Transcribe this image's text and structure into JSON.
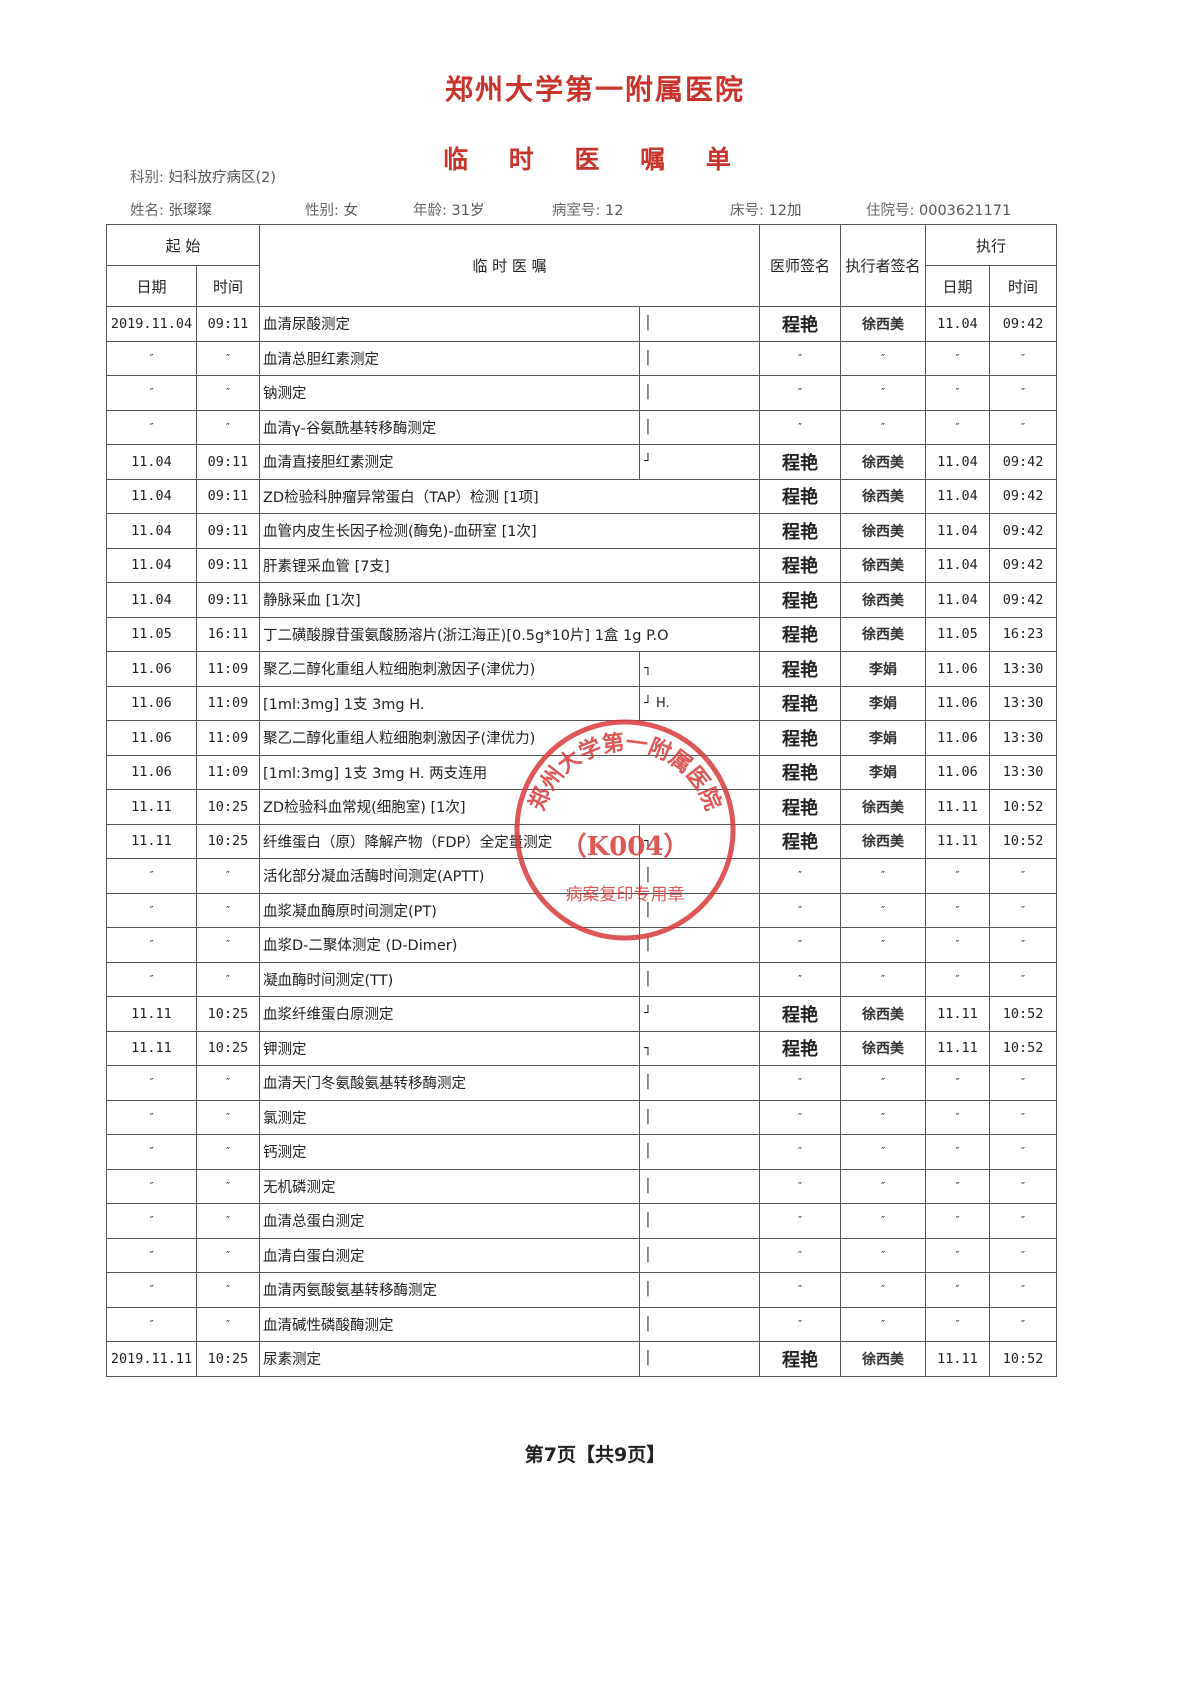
{
  "hospital_name": "郑州大学第一附属医院",
  "doc_title": "临 时 医 嘱 单",
  "patient": {
    "dept_label": "科别:",
    "dept": "妇科放疗病区(2)",
    "name_label": "姓名:",
    "name": "张璨璨",
    "sex_label": "性别:",
    "sex": "女",
    "age_label": "年龄:",
    "age": "31岁",
    "room_label": "病室号:",
    "room": "12",
    "bed_label": "床号:",
    "bed": "12加",
    "admission_label": "住院号:",
    "admission": "0003621171"
  },
  "table": {
    "start_header": "起   始",
    "date_header": "日期",
    "time_header": "时间",
    "order_header": "临 时 医 嘱",
    "doctor_header": "医师签名",
    "executor_header": "执行者签名",
    "exec_header": "执行",
    "exec_date_header": "日期",
    "exec_time_header": "时间",
    "rows": [
      {
        "date": "2019.11.04",
        "time": "09:11",
        "order": "血清尿酸测定",
        "mark": "│",
        "doctor": "程艳",
        "executor": "徐西美",
        "exec_date": "11.04",
        "exec_time": "09:42"
      },
      {
        "date": "″",
        "time": "″",
        "order": "血清总胆红素测定",
        "mark": "│",
        "doctor": "″",
        "executor": "″",
        "exec_date": "″",
        "exec_time": "″"
      },
      {
        "date": "″",
        "time": "″",
        "order": "钠测定",
        "mark": "│",
        "doctor": "″",
        "executor": "″",
        "exec_date": "″",
        "exec_time": "″"
      },
      {
        "date": "″",
        "time": "″",
        "order": "血清γ-谷氨酰基转移酶测定",
        "mark": "│",
        "doctor": "″",
        "executor": "″",
        "exec_date": "″",
        "exec_time": "″"
      },
      {
        "date": "11.04",
        "time": "09:11",
        "order": "血清直接胆红素测定",
        "mark": "┘",
        "doctor": "程艳",
        "executor": "徐西美",
        "exec_date": "11.04",
        "exec_time": "09:42"
      },
      {
        "date": "11.04",
        "time": "09:11",
        "order": "ZD检验科肿瘤异常蛋白（TAP）检测 [1项]",
        "mark": "",
        "doctor": "程艳",
        "executor": "徐西美",
        "exec_date": "11.04",
        "exec_time": "09:42"
      },
      {
        "date": "11.04",
        "time": "09:11",
        "order": "血管内皮生长因子检测(酶免)-血研室 [1次]",
        "mark": "",
        "doctor": "程艳",
        "executor": "徐西美",
        "exec_date": "11.04",
        "exec_time": "09:42"
      },
      {
        "date": "11.04",
        "time": "09:11",
        "order": "肝素锂采血管 [7支]",
        "mark": "",
        "doctor": "程艳",
        "executor": "徐西美",
        "exec_date": "11.04",
        "exec_time": "09:42"
      },
      {
        "date": "11.04",
        "time": "09:11",
        "order": "静脉采血 [1次]",
        "mark": "",
        "doctor": "程艳",
        "executor": "徐西美",
        "exec_date": "11.04",
        "exec_time": "09:42"
      },
      {
        "date": "11.05",
        "time": "16:11",
        "order": "丁二磺酸腺苷蛋氨酸肠溶片(浙江海正)[0.5g*10片] 1盒 1g P.O",
        "mark": "",
        "doctor": "程艳",
        "executor": "徐西美",
        "exec_date": "11.05",
        "exec_time": "16:23"
      },
      {
        "date": "11.06",
        "time": "11:09",
        "order": "聚乙二醇化重组人粒细胞刺激因子(津优力)",
        "mark": "┐",
        "doctor": "程艳",
        "executor": "李娟",
        "exec_date": "11.06",
        "exec_time": "13:30"
      },
      {
        "date": "11.06",
        "time": "11:09",
        "order": "[1ml:3mg] 1支 3mg H.",
        "mark": "┘ H.",
        "doctor": "程艳",
        "executor": "李娟",
        "exec_date": "11.06",
        "exec_time": "13:30"
      },
      {
        "date": "11.06",
        "time": "11:09",
        "order": "聚乙二醇化重组人粒细胞刺激因子(津优力)",
        "mark": "",
        "doctor": "程艳",
        "executor": "李娟",
        "exec_date": "11.06",
        "exec_time": "13:30"
      },
      {
        "date": "11.06",
        "time": "11:09",
        "order": "[1ml:3mg] 1支 3mg H. 两支连用",
        "mark": "",
        "doctor": "程艳",
        "executor": "李娟",
        "exec_date": "11.06",
        "exec_time": "13:30"
      },
      {
        "date": "11.11",
        "time": "10:25",
        "order": "ZD检验科血常规(细胞室) [1次]",
        "mark": "",
        "doctor": "程艳",
        "executor": "徐西美",
        "exec_date": "11.11",
        "exec_time": "10:52"
      },
      {
        "date": "11.11",
        "time": "10:25",
        "order": "纤维蛋白（原）降解产物（FDP）全定量测定",
        "mark": "┐",
        "doctor": "程艳",
        "executor": "徐西美",
        "exec_date": "11.11",
        "exec_time": "10:52"
      },
      {
        "date": "″",
        "time": "″",
        "order": "活化部分凝血活酶时间测定(APTT)",
        "mark": "│",
        "doctor": "″",
        "executor": "″",
        "exec_date": "″",
        "exec_time": "″"
      },
      {
        "date": "″",
        "time": "″",
        "order": "血浆凝血酶原时间测定(PT)",
        "mark": "│",
        "doctor": "″",
        "executor": "″",
        "exec_date": "″",
        "exec_time": "″"
      },
      {
        "date": "″",
        "time": "″",
        "order": "血浆D-二聚体测定 (D-Dimer)",
        "mark": "│",
        "doctor": "″",
        "executor": "″",
        "exec_date": "″",
        "exec_time": "″"
      },
      {
        "date": "″",
        "time": "″",
        "order": "凝血酶时间测定(TT)",
        "mark": "│",
        "doctor": "″",
        "executor": "″",
        "exec_date": "″",
        "exec_time": "″"
      },
      {
        "date": "11.11",
        "time": "10:25",
        "order": "血浆纤维蛋白原测定",
        "mark": "┘",
        "doctor": "程艳",
        "executor": "徐西美",
        "exec_date": "11.11",
        "exec_time": "10:52"
      },
      {
        "date": "11.11",
        "time": "10:25",
        "order": "钾测定",
        "mark": "┐",
        "doctor": "程艳",
        "executor": "徐西美",
        "exec_date": "11.11",
        "exec_time": "10:52"
      },
      {
        "date": "″",
        "time": "″",
        "order": "血清天门冬氨酸氨基转移酶测定",
        "mark": "│",
        "doctor": "″",
        "executor": "″",
        "exec_date": "″",
        "exec_time": "″"
      },
      {
        "date": "″",
        "time": "″",
        "order": "氯测定",
        "mark": "│",
        "doctor": "″",
        "executor": "″",
        "exec_date": "″",
        "exec_time": "″"
      },
      {
        "date": "″",
        "time": "″",
        "order": "钙测定",
        "mark": "│",
        "doctor": "″",
        "executor": "″",
        "exec_date": "″",
        "exec_time": "″"
      },
      {
        "date": "″",
        "time": "″",
        "order": "无机磷测定",
        "mark": "│",
        "doctor": "″",
        "executor": "″",
        "exec_date": "″",
        "exec_time": "″"
      },
      {
        "date": "″",
        "time": "″",
        "order": "血清总蛋白测定",
        "mark": "│",
        "doctor": "″",
        "executor": "″",
        "exec_date": "″",
        "exec_time": "″"
      },
      {
        "date": "″",
        "time": "″",
        "order": "血清白蛋白测定",
        "mark": "│",
        "doctor": "″",
        "executor": "″",
        "exec_date": "″",
        "exec_time": "″"
      },
      {
        "date": "″",
        "time": "″",
        "order": "血清丙氨酸氨基转移酶测定",
        "mark": "│",
        "doctor": "″",
        "executor": "″",
        "exec_date": "″",
        "exec_time": "″"
      },
      {
        "date": "″",
        "time": "″",
        "order": "血清碱性磷酸酶测定",
        "mark": "│",
        "doctor": "″",
        "executor": "″",
        "exec_date": "″",
        "exec_time": "″"
      },
      {
        "date": "2019.11.11",
        "time": "10:25",
        "order": "尿素测定",
        "mark": "│",
        "doctor": "程艳",
        "executor": "徐西美",
        "exec_date": "11.11",
        "exec_time": "10:52"
      }
    ]
  },
  "page_number": "第7页【共9页】",
  "stamp": {
    "text_top": "郑州大学第一附属医院",
    "code": "（K004）",
    "text_bottom": "病案复印专用章",
    "color": "#d83a3a"
  },
  "colors": {
    "title": "#c8332b",
    "stamp": "#d83a3a",
    "border": "#555555"
  }
}
